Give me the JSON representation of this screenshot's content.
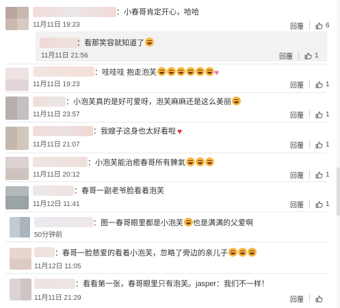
{
  "reply_label": "回覆",
  "comments": [
    {
      "text": "小春哥肯定开心，哈哈",
      "time": "11月11日 19:23",
      "likes": "6"
    },
    {
      "text": "看那笑容就知道了",
      "time": "11月11日 21:56",
      "likes": "1"
    },
    {
      "text": "哇哇哇 抱走泡芙",
      "time": "11月11日 19:23",
      "likes": "1"
    },
    {
      "text": "小泡芙真的是好可爱呀，泡芙麻麻还是这么美丽",
      "time": "11月11日 23:57",
      "likes": "1"
    },
    {
      "text": "我嫂子这身也太好看啦",
      "time": "11月11日 21:07",
      "likes": "1"
    },
    {
      "text": "小泡芙能治癒春哥所有脾氣",
      "time": "11月11日 20:12",
      "likes": "1"
    },
    {
      "text": "春哥一副老爷脸看着泡芙",
      "time": "11月12日 11:41",
      "likes": "1"
    },
    {
      "text": "图一春哥眼里都是小泡芙",
      "text2": "也是满满的父爱啊",
      "time": "50分钟前",
      "likes": ""
    },
    {
      "text": "春哥一脸慈爱的看着小泡芙，忽略了旁边的亲儿子",
      "time": "11月12日 11:05",
      "likes": ""
    },
    {
      "text": "看看第一张，春哥眼里只有泡芙。jasper：我们不一样！",
      "time": "11月11日 21:29",
      "likes": ""
    }
  ]
}
